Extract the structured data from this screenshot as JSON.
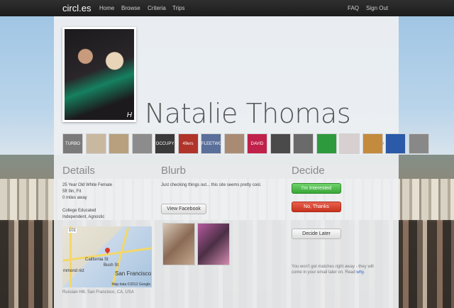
{
  "nav": {
    "logo": "circl.es",
    "links": [
      "Home",
      "Browse",
      "Criteria",
      "Trips"
    ],
    "right": [
      "FAQ",
      "Sign Out"
    ]
  },
  "profile": {
    "name": "Natalie Thomas",
    "photo_tag": "H"
  },
  "likes": [
    {
      "label": "TURBO",
      "color": "#7a7a7a"
    },
    {
      "label": "",
      "color": "#c9b8a0"
    },
    {
      "label": "",
      "color": "#b8a07e"
    },
    {
      "label": "",
      "color": "#8c8c8c"
    },
    {
      "label": "OCCUPY SF",
      "color": "#3a3a3a"
    },
    {
      "label": "49ers",
      "color": "#b0342a"
    },
    {
      "label": "FLEETWOOD",
      "color": "#5a6f9a"
    },
    {
      "label": "",
      "color": "#a98b74"
    },
    {
      "label": "DAVID GUETTA",
      "color": "#c0214a"
    },
    {
      "label": "",
      "color": "#4a4a4a"
    },
    {
      "label": "",
      "color": "#6a6a6a"
    },
    {
      "label": "",
      "color": "#2e9a3e"
    },
    {
      "label": "",
      "color": "#d8d0d0"
    },
    {
      "label": "",
      "color": "#c48a3e"
    },
    {
      "label": "",
      "color": "#2a5aa8"
    },
    {
      "label": "",
      "color": "#888888"
    }
  ],
  "details": {
    "heading": "Details",
    "line1": "25 Year Old White Female",
    "line2": "5ft 9in, Fit",
    "line3": "0 miles away",
    "line4": "College Educated",
    "line5": "Independent, Agnostic",
    "map_location": "Russian Hill, San Francisco, CA, USA",
    "map_labels": {
      "highway": "101",
      "street": "California St",
      "street2": "Bush St",
      "area": "San Francisco",
      "area_left": "mmond rict",
      "copyright": "Map data ©2012 Google"
    }
  },
  "blurb": {
    "heading": "Blurb",
    "text": "Just checking things out... this site seems pretty cool.",
    "view_facebook": "View Facebook"
  },
  "decide": {
    "heading": "Decide",
    "interested": "I'm Interested",
    "no_thanks": "No, Thanks",
    "decide_later": "Decide Later",
    "note": "You won't get matches right away - they will come in your email later on. Read",
    "note_link": "why",
    "note_end": "."
  },
  "colors": {
    "green": "#4cb84a",
    "red": "#d2412c",
    "link": "#2a63c7"
  }
}
